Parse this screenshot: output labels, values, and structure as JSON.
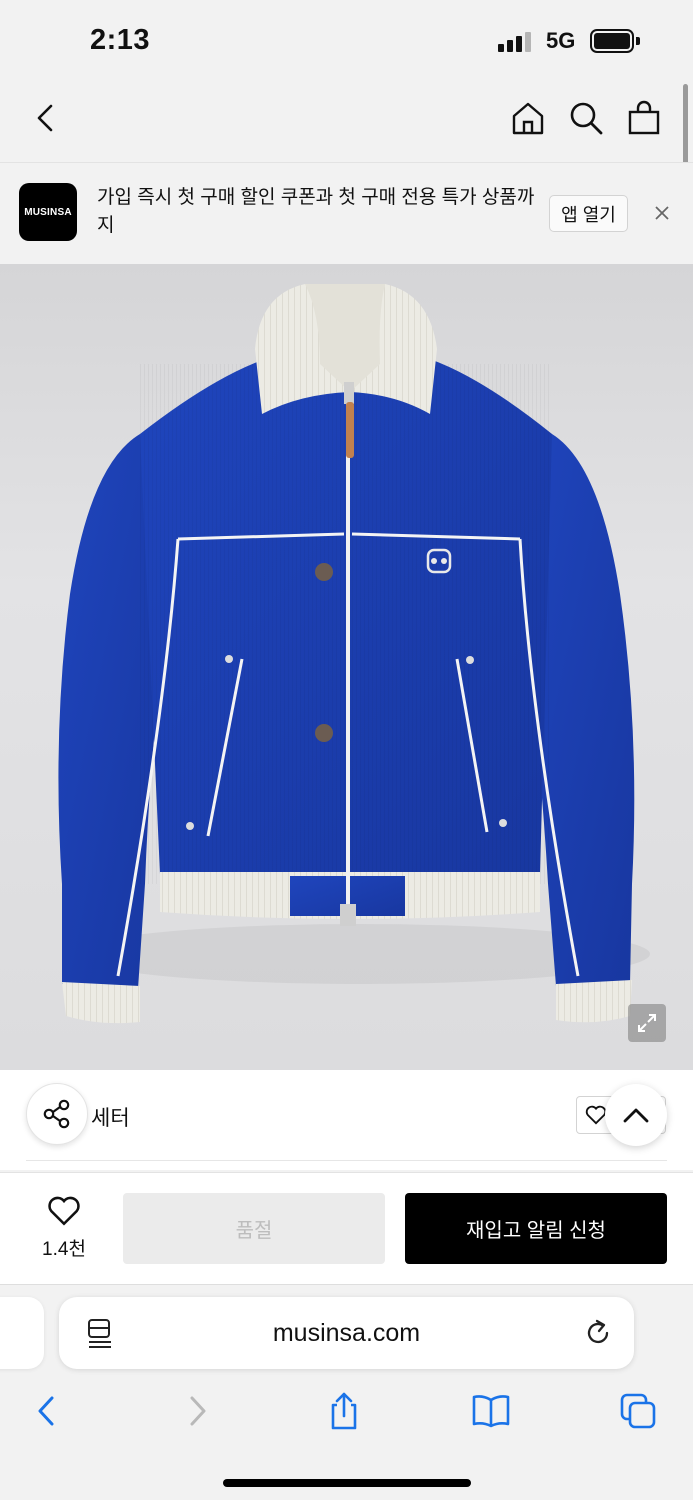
{
  "status_bar": {
    "time": "2:13",
    "network": "5G"
  },
  "nav": {
    "back_icon": "chevron-left-icon",
    "home_icon": "home-icon",
    "search_icon": "search-icon",
    "cart_icon": "shopping-bag-icon"
  },
  "promo_banner": {
    "logo_text": "MUSINSA",
    "message": "가입 즉시 첫 구매 할인 쿠폰과 첫 구매 전용 특가 상품까지",
    "open_app_label": "앱 열기",
    "close_icon": "close-icon"
  },
  "product": {
    "image_alt_icon": "jacket-illustration",
    "expand_icon": "expand-icon",
    "category": "세터",
    "share_icon": "share-icon",
    "scroll_top_icon": "chevron-up-icon"
  },
  "action_bar": {
    "wish_icon": "heart-icon",
    "wish_count": "1.4천",
    "soldout_label": "품절",
    "restock_label": "재입고 알림 신청"
  },
  "browser": {
    "url": "musinsa.com",
    "reader_icon": "reader-mode-icon",
    "reload_icon": "reload-icon",
    "back_icon": "chevron-left-icon",
    "forward_icon": "chevron-right-icon",
    "share_icon": "share-up-icon",
    "bookmarks_icon": "book-icon",
    "tabs_icon": "tabs-icon"
  },
  "colors": {
    "accent_blue": "#1a73e8",
    "jacket_blue": "#1c3fb0",
    "rib_cream": "#ecebe4",
    "button_black": "#000000"
  }
}
